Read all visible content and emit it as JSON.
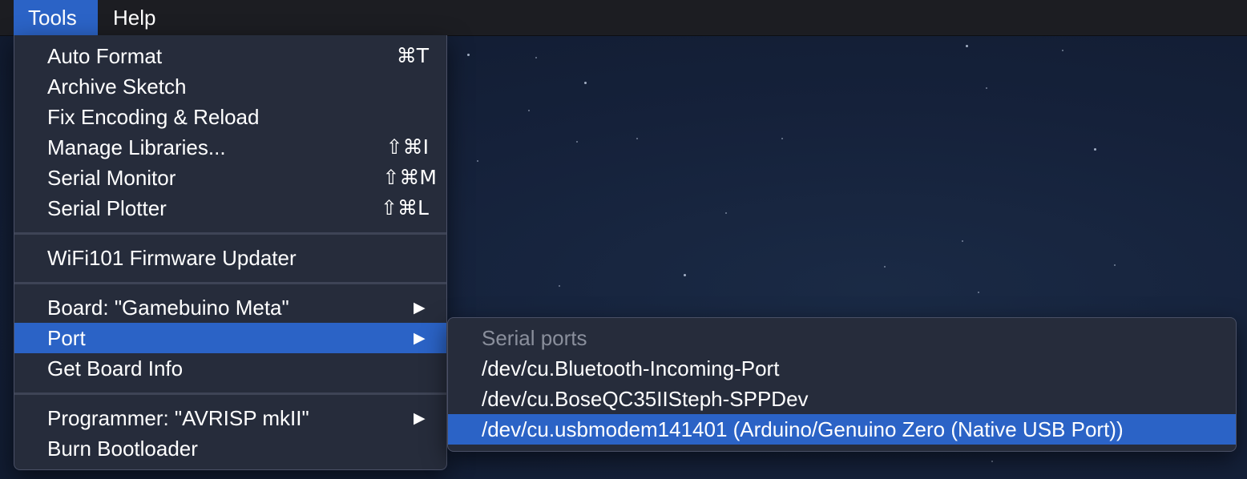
{
  "menubar": {
    "items": [
      {
        "label": "Tools",
        "active": true
      },
      {
        "label": "Help",
        "active": false
      }
    ]
  },
  "tools_menu": {
    "items": [
      {
        "label": "Auto Format",
        "shortcut": "⌘T"
      },
      {
        "label": "Archive Sketch",
        "shortcut": ""
      },
      {
        "label": "Fix Encoding & Reload",
        "shortcut": ""
      },
      {
        "label": "Manage Libraries...",
        "shortcut": "⇧⌘I"
      },
      {
        "label": "Serial Monitor",
        "shortcut": "⇧⌘M"
      },
      {
        "label": "Serial Plotter",
        "shortcut": "⇧⌘L"
      },
      {
        "label": "WiFi101 Firmware Updater",
        "shortcut": ""
      },
      {
        "label": "Board: \"Gamebuino Meta\"",
        "submenu_arrow": "▶"
      },
      {
        "label": "Port",
        "submenu_arrow": "▶",
        "selected": true
      },
      {
        "label": "Get Board Info",
        "shortcut": ""
      },
      {
        "label": "Programmer: \"AVRISP mkII\"",
        "submenu_arrow": "▶"
      },
      {
        "label": "Burn Bootloader",
        "shortcut": ""
      }
    ]
  },
  "port_submenu": {
    "header": "Serial ports",
    "items": [
      {
        "label": "/dev/cu.Bluetooth-Incoming-Port"
      },
      {
        "label": "/dev/cu.BoseQC35IISteph-SPPDev"
      },
      {
        "label": "/dev/cu.usbmodem141401 (Arduino/Genuino Zero (Native USB Port))",
        "selected": true
      }
    ]
  },
  "colors": {
    "selection": "#2b63c6",
    "menu_bg": "#262c3b",
    "menubar_bg": "#1c1d22",
    "header_text": "#8a8f9c"
  }
}
